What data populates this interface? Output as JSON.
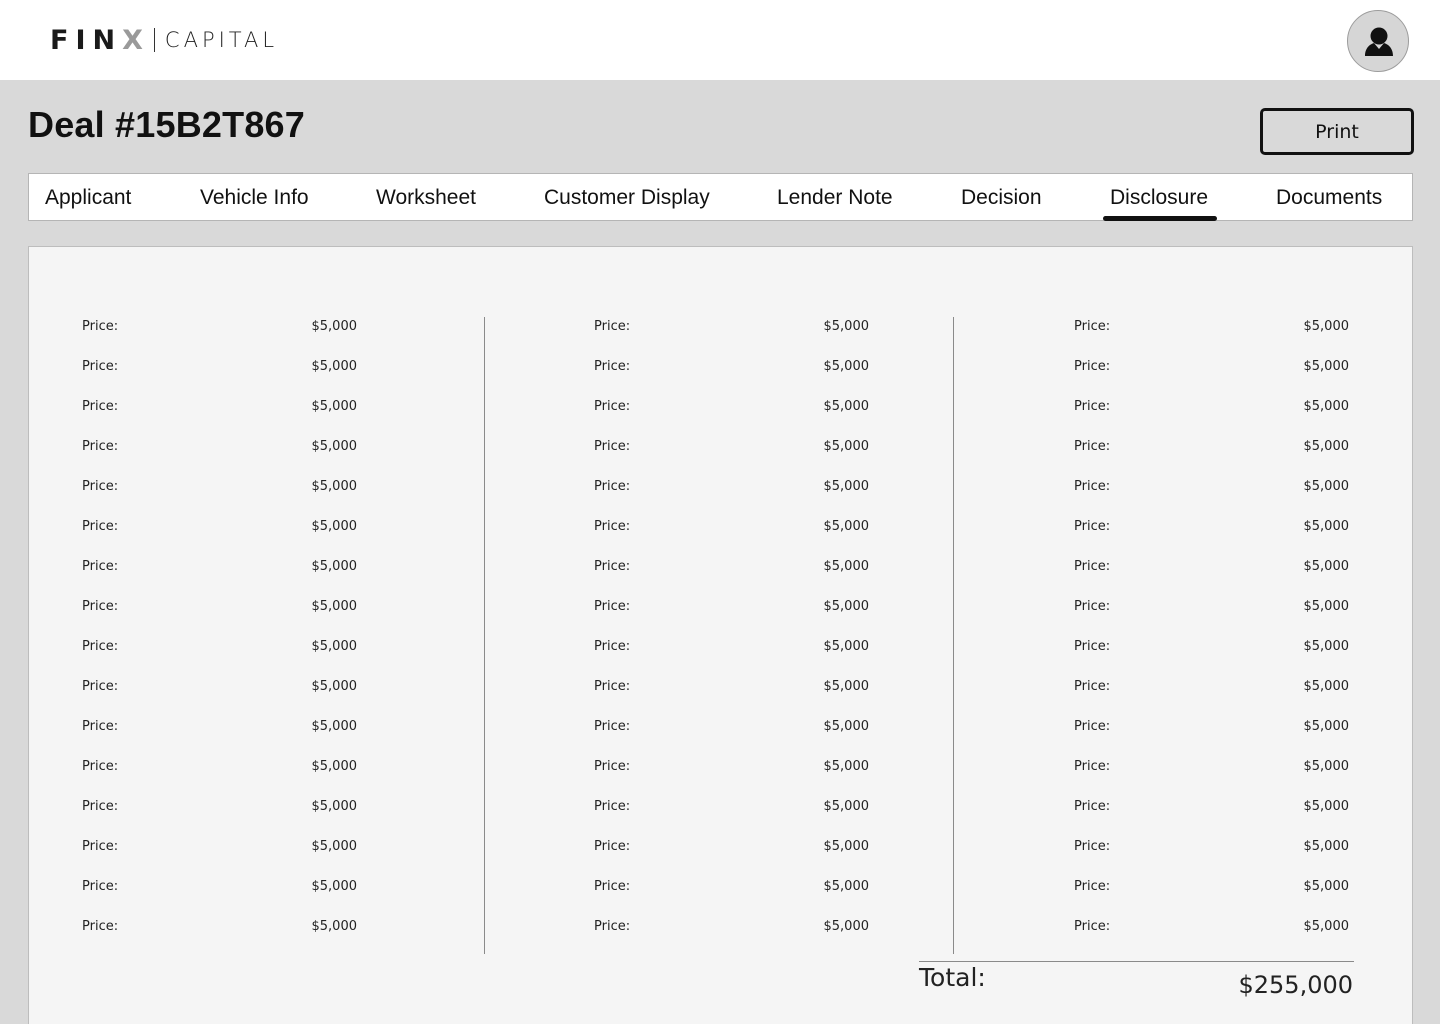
{
  "brand": {
    "mark_main": "FIN",
    "mark_accent": "X",
    "word": "CAPITAL"
  },
  "header": {
    "title": "Deal #15B2T867",
    "print_label": "Print"
  },
  "tabs": [
    {
      "label": "Applicant"
    },
    {
      "label": "Vehicle Info"
    },
    {
      "label": "Worksheet"
    },
    {
      "label": "Customer Display"
    },
    {
      "label": "Lender Note"
    },
    {
      "label": "Decision"
    },
    {
      "label": "Disclosure",
      "active": true
    },
    {
      "label": "Documents"
    }
  ],
  "disclosure": {
    "columns": [
      {
        "rows": [
          {
            "label": "Price:",
            "value": "$5,000"
          },
          {
            "label": "Price:",
            "value": "$5,000"
          },
          {
            "label": "Price:",
            "value": "$5,000"
          },
          {
            "label": "Price:",
            "value": "$5,000"
          },
          {
            "label": "Price:",
            "value": "$5,000"
          },
          {
            "label": "Price:",
            "value": "$5,000"
          },
          {
            "label": "Price:",
            "value": "$5,000"
          },
          {
            "label": "Price:",
            "value": "$5,000"
          },
          {
            "label": "Price:",
            "value": "$5,000"
          },
          {
            "label": "Price:",
            "value": "$5,000"
          },
          {
            "label": "Price:",
            "value": "$5,000"
          },
          {
            "label": "Price:",
            "value": "$5,000"
          },
          {
            "label": "Price:",
            "value": "$5,000"
          },
          {
            "label": "Price:",
            "value": "$5,000"
          },
          {
            "label": "Price:",
            "value": "$5,000"
          },
          {
            "label": "Price:",
            "value": "$5,000"
          }
        ]
      },
      {
        "rows": [
          {
            "label": "Price:",
            "value": "$5,000"
          },
          {
            "label": "Price:",
            "value": "$5,000"
          },
          {
            "label": "Price:",
            "value": "$5,000"
          },
          {
            "label": "Price:",
            "value": "$5,000"
          },
          {
            "label": "Price:",
            "value": "$5,000"
          },
          {
            "label": "Price:",
            "value": "$5,000"
          },
          {
            "label": "Price:",
            "value": "$5,000"
          },
          {
            "label": "Price:",
            "value": "$5,000"
          },
          {
            "label": "Price:",
            "value": "$5,000"
          },
          {
            "label": "Price:",
            "value": "$5,000"
          },
          {
            "label": "Price:",
            "value": "$5,000"
          },
          {
            "label": "Price:",
            "value": "$5,000"
          },
          {
            "label": "Price:",
            "value": "$5,000"
          },
          {
            "label": "Price:",
            "value": "$5,000"
          },
          {
            "label": "Price:",
            "value": "$5,000"
          },
          {
            "label": "Price:",
            "value": "$5,000"
          }
        ]
      },
      {
        "rows": [
          {
            "label": "Price:",
            "value": "$5,000"
          },
          {
            "label": "Price:",
            "value": "$5,000"
          },
          {
            "label": "Price:",
            "value": "$5,000"
          },
          {
            "label": "Price:",
            "value": "$5,000"
          },
          {
            "label": "Price:",
            "value": "$5,000"
          },
          {
            "label": "Price:",
            "value": "$5,000"
          },
          {
            "label": "Price:",
            "value": "$5,000"
          },
          {
            "label": "Price:",
            "value": "$5,000"
          },
          {
            "label": "Price:",
            "value": "$5,000"
          },
          {
            "label": "Price:",
            "value": "$5,000"
          },
          {
            "label": "Price:",
            "value": "$5,000"
          },
          {
            "label": "Price:",
            "value": "$5,000"
          },
          {
            "label": "Price:",
            "value": "$5,000"
          },
          {
            "label": "Price:",
            "value": "$5,000"
          },
          {
            "label": "Price:",
            "value": "$5,000"
          },
          {
            "label": "Price:",
            "value": "$5,000"
          }
        ]
      }
    ],
    "total_label": "Total:",
    "total_value": "$255,000"
  },
  "icons": {
    "avatar": "user-icon"
  }
}
